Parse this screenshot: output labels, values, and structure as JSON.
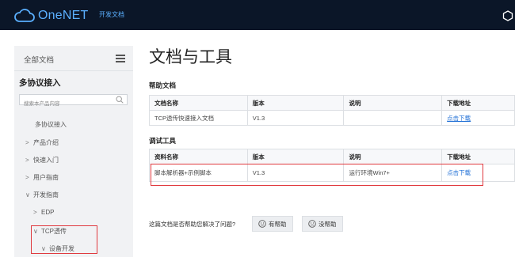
{
  "topbar": {
    "logo_text": "OneNET",
    "nav_link": "开发文档"
  },
  "sidebar": {
    "header_label": "全部文档",
    "section_title": "多协议接入",
    "search_placeholder": "搜索本产品内容",
    "items": [
      {
        "label": "多协议接入",
        "chevron": ""
      },
      {
        "label": "产品介绍",
        "chevron": ">"
      },
      {
        "label": "快速入门",
        "chevron": ">"
      },
      {
        "label": "用户指南",
        "chevron": ">"
      },
      {
        "label": "开发指南",
        "chevron": "∨"
      },
      {
        "label": "EDP",
        "chevron": ">"
      },
      {
        "label": "TCP透传",
        "chevron": "∨"
      },
      {
        "label": "设备开发",
        "chevron": "∨"
      }
    ]
  },
  "main": {
    "title": "文档与工具",
    "help_section": {
      "title": "帮助文档",
      "headers": [
        "文档名称",
        "版本",
        "说明",
        "下载地址"
      ],
      "rows": [
        {
          "name": "TCP透传快速接入文档",
          "version": "V1.3",
          "desc": "",
          "link": "点击下载"
        }
      ]
    },
    "debug_section": {
      "title": "调试工具",
      "headers": [
        "资料名称",
        "版本",
        "说明",
        "下载地址"
      ],
      "rows": [
        {
          "name": "脚本解析器+示例脚本",
          "version": "V1.3",
          "desc": "运行环境Win7+",
          "link": "点击下载"
        }
      ]
    },
    "feedback": {
      "question": "这篇文档是否帮助您解决了问题?",
      "helpful": "有帮助",
      "not_helpful": "没帮助"
    }
  },
  "colors": {
    "topbar_bg": "#0b1628",
    "brand": "#5bb0ff",
    "link": "#1f6fd6",
    "highlight": "#e0393e"
  }
}
